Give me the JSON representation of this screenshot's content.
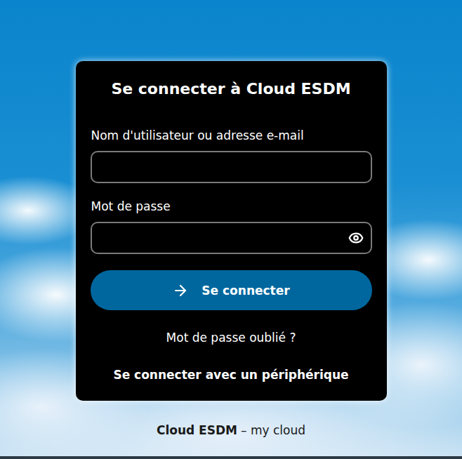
{
  "title": "Se connecter à Cloud ESDM",
  "fields": [
    {
      "label": "Nom d'utilisateur ou adresse e-mail",
      "value": "",
      "kind": "text"
    },
    {
      "label": "Mot de passe",
      "value": "",
      "kind": "password"
    }
  ],
  "submit": "Se connecter",
  "links": [
    {
      "label": "Mot de passe oublié ?",
      "bold": false
    },
    {
      "label": "Se connecter avec un périphérique",
      "bold": true
    }
  ],
  "footer": {
    "name": "Cloud ESDM",
    "slogan": "– my cloud"
  }
}
